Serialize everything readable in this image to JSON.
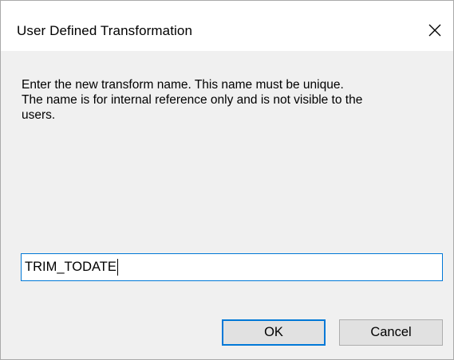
{
  "window": {
    "title": "User Defined Transformation",
    "close_icon": "close-icon"
  },
  "message": {
    "line1": "Enter the new transform name. This name must be unique.",
    "line2": "The name is for internal reference only and is not visible to the",
    "line3": "users."
  },
  "name_input": {
    "value": "TRIM_TODATE"
  },
  "buttons": {
    "ok_label": "OK",
    "cancel_label": "Cancel"
  },
  "colors": {
    "accent": "#0078d7",
    "dialog_background": "#f0f0f0",
    "button_background": "#e1e1e1"
  }
}
